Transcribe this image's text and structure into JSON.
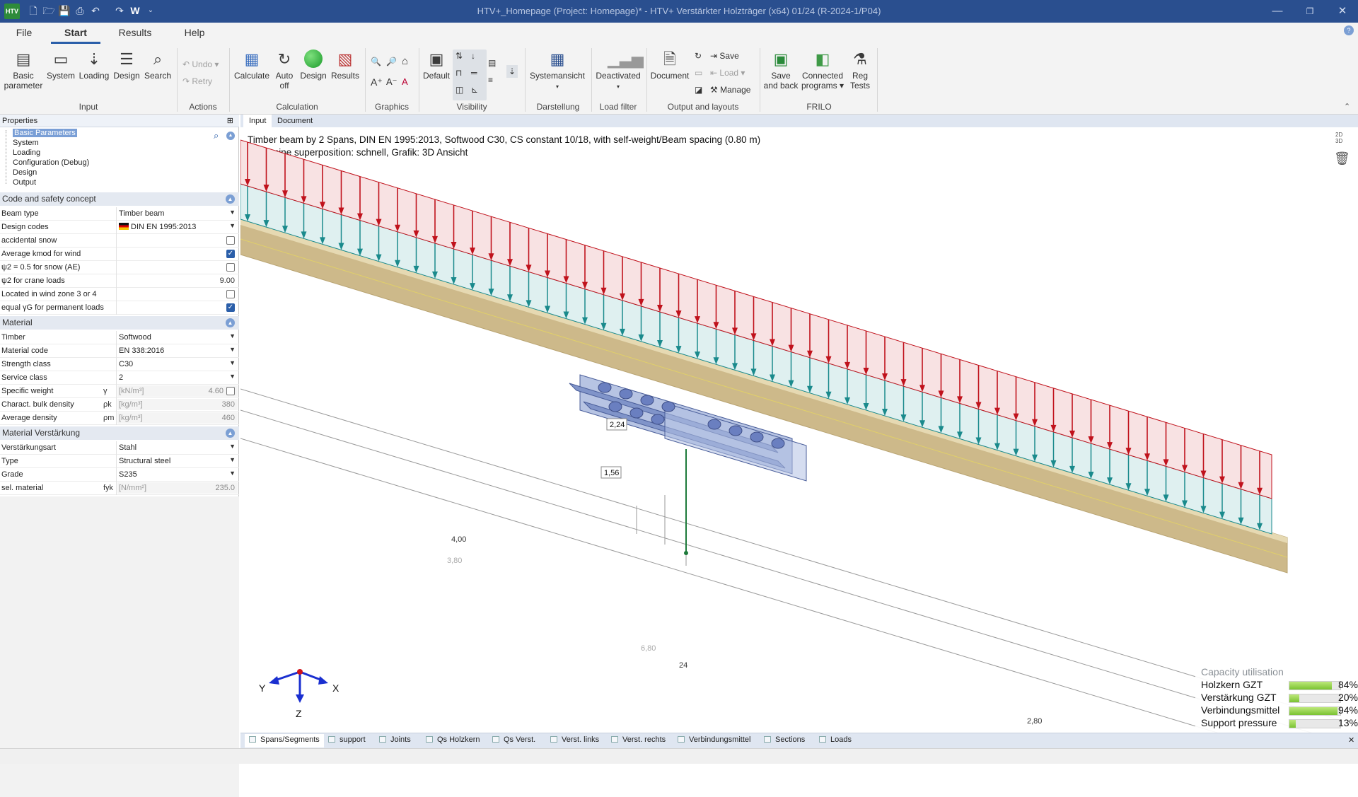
{
  "titlebar": {
    "logo": "HTV",
    "title": "HTV+_Homepage (Project: Homepage)* - HTV+ Verstärkter Holzträger (x64) 01/24 (R-2024-1/P04)",
    "quick_w": "W"
  },
  "tabs": [
    "File",
    "Start",
    "Results",
    "Help"
  ],
  "ribbon": {
    "input": {
      "basic1": "Basic",
      "basic2": "parameter",
      "system": "System",
      "loading": "Loading",
      "design": "Design",
      "search": "Search",
      "label": "Input"
    },
    "actions": {
      "undo": "Undo",
      "retry": "Retry",
      "label": "Actions"
    },
    "calculation": {
      "calculate": "Calculate",
      "auto1": "Auto",
      "auto2": "off",
      "design": "Design",
      "results": "Results",
      "label": "Calculation"
    },
    "graphics": {
      "label": "Graphics"
    },
    "visibility": {
      "default": "Default",
      "label": "Visibility"
    },
    "darstellung": {
      "systemansicht": "Systemansicht",
      "label": "Darstellung"
    },
    "loadfilter": {
      "deactivated": "Deactivated",
      "label": "Load filter"
    },
    "output": {
      "document": "Document",
      "save": "Save",
      "load": "Load",
      "manage": "Manage",
      "label": "Output and layouts"
    },
    "frilo": {
      "save1": "Save",
      "save2": "and back",
      "conn1": "Connected",
      "conn2": "programs",
      "reg1": "Reg",
      "reg2": "Tests",
      "label": "FRILO"
    }
  },
  "left": {
    "header": "Properties",
    "tree": [
      "Basic Parameters",
      "System",
      "Loading",
      "Configuration (Debug)",
      "Design",
      "Output"
    ],
    "sections": {
      "code": "Code and safety concept",
      "material": "Material",
      "reinforcement": "Material Verstärkung"
    },
    "code_rows": [
      {
        "label": "Beam type",
        "value": "Timber beam"
      },
      {
        "label": "Design codes",
        "value": "DIN EN 1995:2013"
      },
      {
        "label": "accidental snow"
      },
      {
        "label": "Average kmod for wind"
      },
      {
        "label": "ψ2 = 0.5 for snow (AE)"
      },
      {
        "label": "ψ2 for crane loads",
        "num": "9.00"
      },
      {
        "label": "Located in wind zone 3 or 4"
      },
      {
        "label": "equal γG for permanent loads"
      }
    ],
    "material_rows": [
      {
        "label": "Timber",
        "value": "Softwood"
      },
      {
        "label": "Material code",
        "value": "EN 338:2016"
      },
      {
        "label": "Strength class",
        "value": "C30"
      },
      {
        "label": "Service class",
        "value": "2"
      },
      {
        "label": "Specific weight",
        "sym": "γ",
        "unit": "[kN/m³]",
        "num": "4.60"
      },
      {
        "label": "Charact. bulk density",
        "sym": "ρk",
        "unit": "[kg/m³]",
        "num": "380"
      },
      {
        "label": "Average density",
        "sym": "ρm",
        "unit": "[kg/m³]",
        "num": "460"
      }
    ],
    "reinf_rows": [
      {
        "label": "Verstärkungsart",
        "value": "Stahl"
      },
      {
        "label": "Type",
        "value": "Structural steel"
      },
      {
        "label": "Grade",
        "value": "S235"
      },
      {
        "label": "sel. material",
        "sym": "fyk",
        "unit": "[N/mm²]",
        "num": "235.0"
      }
    ]
  },
  "doc_tabs": [
    "Input",
    "Document"
  ],
  "canvas": {
    "line1": "Timber beam by 2 Spans, DIN EN 1995:2013, Softwood C30, CS constant 10/18, with self-weight/Beam spacing (0.80 m)",
    "line2": "Determine superposition: schnell, Grafik: 3D Ansicht",
    "load_red": "2,24",
    "load_teal": "1,56",
    "dims": [
      "4,00",
      "3,80",
      "6,80",
      "24",
      "2,80"
    ],
    "axes": {
      "x": "X",
      "y": "Y",
      "z": "Z"
    },
    "view_2d": "2D",
    "view_3d": "3D"
  },
  "capacity": {
    "title": "Capacity utilisation",
    "rows": [
      {
        "label": "Holzkern GZT",
        "pct": "84%",
        "value": 0.84
      },
      {
        "label": "Verstärkung GZT",
        "pct": "20%",
        "value": 0.2
      },
      {
        "label": "Verbindungsmittel",
        "pct": "94%",
        "value": 0.94
      },
      {
        "label": "Support  pressure",
        "pct": "13%",
        "value": 0.13
      }
    ]
  },
  "bottom_tabs": [
    "Spans/Segments",
    "support",
    "Joints",
    "Qs Holzkern",
    "Qs Verst.",
    "Verst. links",
    "Verst. rechts",
    "Verbindungsmittel",
    "Sections",
    "Loads"
  ],
  "colors": {
    "titlebar": "#2a4f8f",
    "load_red": "#c0121c",
    "load_teal": "#1a8a8c",
    "beam": "#cdb98a",
    "steel": "#7f93c9"
  }
}
